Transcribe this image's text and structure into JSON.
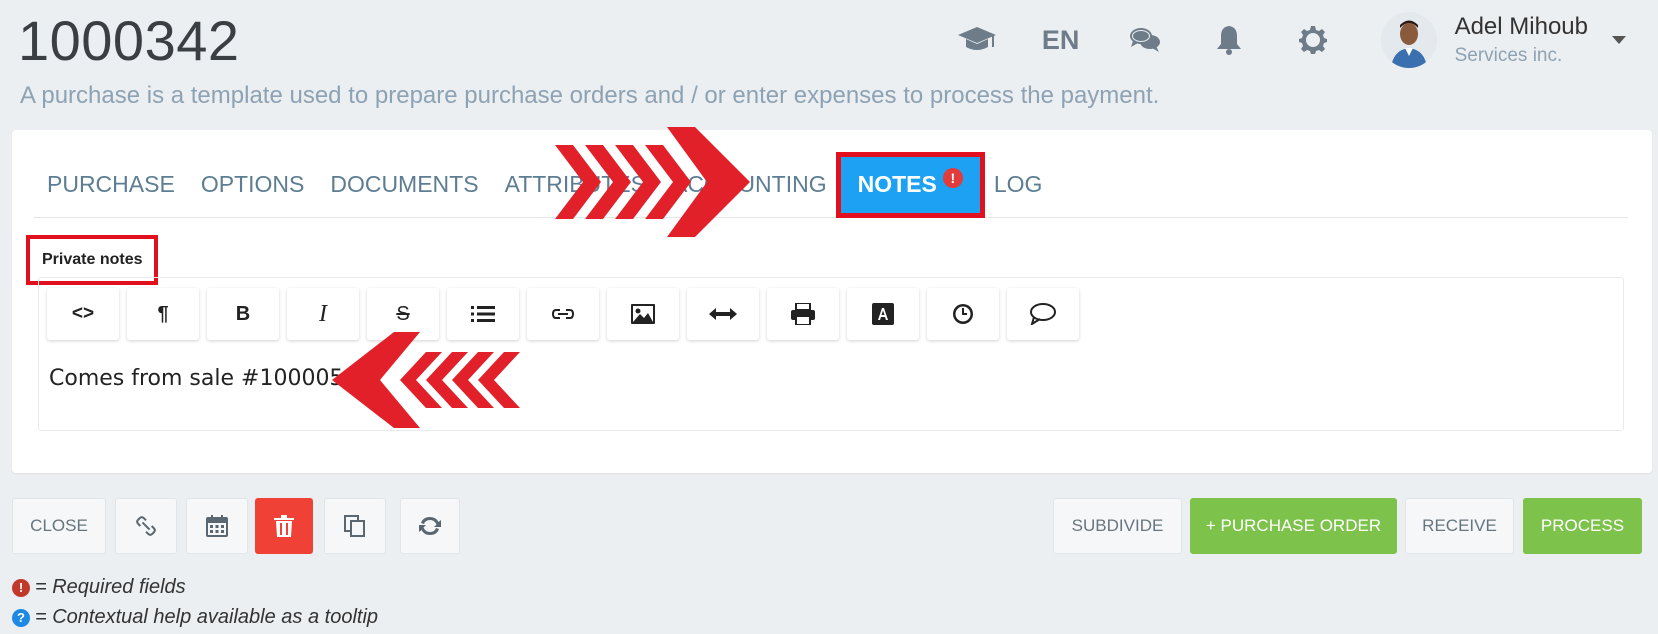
{
  "header": {
    "title": "1000342",
    "description": "A purchase is a template used to prepare purchase orders and / or enter expenses to process the payment."
  },
  "topbar": {
    "language": "EN",
    "user_name": "Adel Mihoub",
    "user_company": "Services inc.",
    "icons": [
      "graduation-cap-icon",
      "chat-icon",
      "bell-icon",
      "gear-icon",
      "caret-down-icon"
    ]
  },
  "tabs": [
    {
      "label": "PURCHASE",
      "active": false
    },
    {
      "label": "OPTIONS",
      "active": false
    },
    {
      "label": "DOCUMENTS",
      "active": false
    },
    {
      "label": "ATTRIBUTES",
      "active": false
    },
    {
      "label": "ACCOUNTING",
      "active": false
    },
    {
      "label": "NOTES",
      "active": true,
      "badge": "!"
    },
    {
      "label": "LOG",
      "active": false
    }
  ],
  "notes": {
    "field_label": "Private notes",
    "toolbar_buttons": [
      "code-view",
      "paragraph",
      "bold",
      "italic",
      "strikethrough",
      "list",
      "link",
      "image",
      "horizontal-rule",
      "print",
      "font-color",
      "clock",
      "comment"
    ],
    "toolbar_glyphs": {
      "code": "<>",
      "paragraph": "¶",
      "bold": "B",
      "italic": "I",
      "strike": "S"
    },
    "content": "Comes from sale #1000059"
  },
  "actions": {
    "close": "CLOSE",
    "subdivide": "SUBDIVIDE",
    "purchase_order": "+ PURCHASE ORDER",
    "receive": "RECEIVE",
    "process": "PROCESS"
  },
  "legend": {
    "required": "= Required fields",
    "help": "= Contextual help available as a tooltip",
    "required_glyph": "!",
    "help_glyph": "?"
  },
  "colors": {
    "accent": "#1da1f2",
    "annotation_red": "#e2101f",
    "green": "#7dc24b",
    "danger": "#ef4136"
  }
}
